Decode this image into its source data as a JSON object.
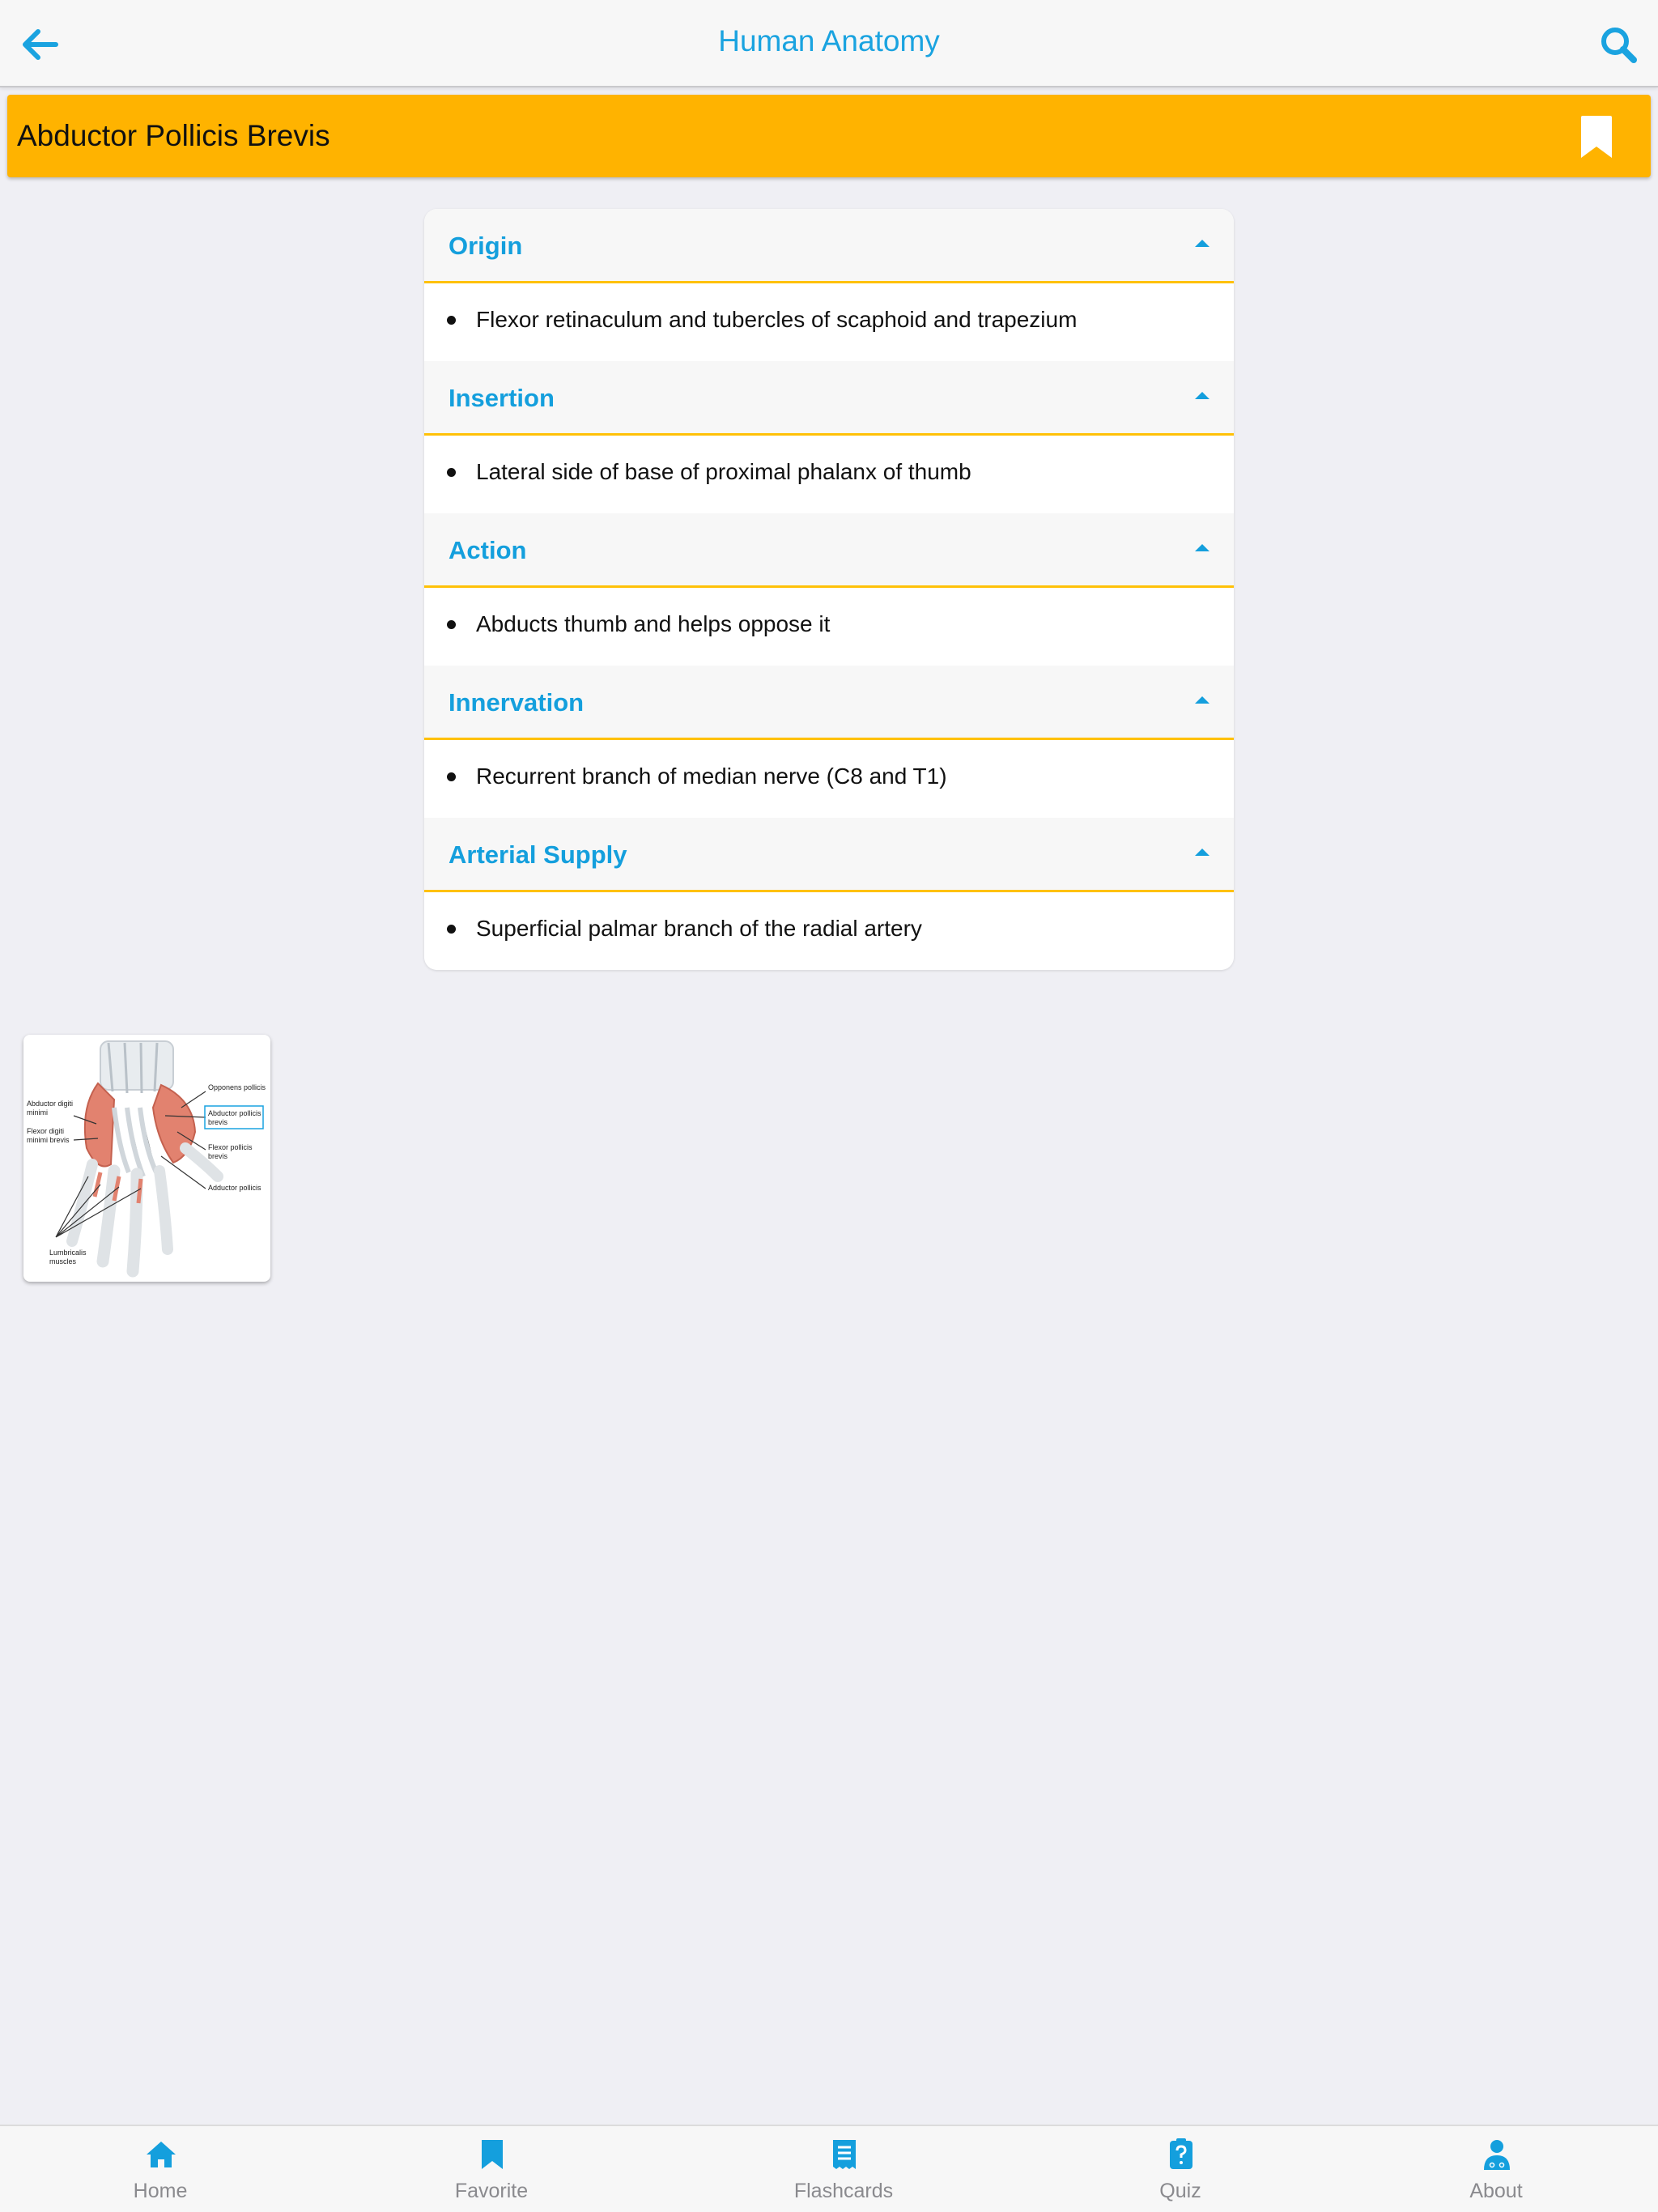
{
  "header": {
    "title": "Human Anatomy",
    "back_icon": "arrow-left-icon",
    "search_icon": "search-icon"
  },
  "muscle": {
    "name": "Abductor Pollicis Brevis",
    "bookmark_icon": "bookmark-icon"
  },
  "sections": [
    {
      "title": "Origin",
      "body": "Flexor retinaculum and tubercles of scaphoid and trapezium"
    },
    {
      "title": "Insertion",
      "body": "Lateral side of base of proximal phalanx of thumb"
    },
    {
      "title": "Action",
      "body": "Abducts thumb and helps oppose it"
    },
    {
      "title": "Innervation",
      "body": "Recurrent branch of median nerve (C8 and T1)"
    },
    {
      "title": "Arterial Supply",
      "body": "Superficial palmar branch of the radial artery"
    }
  ],
  "image": {
    "labels": {
      "opponens": "Opponens pollicis",
      "abd_digiti_1": "Abductor digiti",
      "abd_digiti_2": "minimi",
      "abd_pollicis_1": "Abductor pollicis",
      "abd_pollicis_2": "brevis",
      "flexor_digiti_1": "Flexor digiti",
      "flexor_digiti_2": "minimi brevis",
      "flexor_pollicis_1": "Flexor pollicis",
      "flexor_pollicis_2": "brevis",
      "adductor": "Adductor pollicis",
      "lumbricals_1": "Lumbricalis",
      "lumbricals_2": "muscles"
    }
  },
  "tabs": [
    {
      "label": "Home",
      "icon": "home-icon"
    },
    {
      "label": "Favorite",
      "icon": "bookmark-icon"
    },
    {
      "label": "Flashcards",
      "icon": "flashcards-icon"
    },
    {
      "label": "Quiz",
      "icon": "quiz-icon"
    },
    {
      "label": "About",
      "icon": "doctor-icon"
    }
  ],
  "colors": {
    "accent": "#1aa3e0",
    "header_bar": "#ffb300",
    "divider": "#ffc107",
    "background": "#efeff4",
    "tab_label": "#8a8a8e"
  }
}
